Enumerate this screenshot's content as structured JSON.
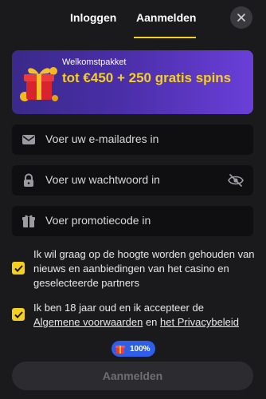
{
  "tabs": {
    "login": "Inloggen",
    "register": "Aanmelden",
    "active": "register"
  },
  "banner": {
    "title": "Welkomstpakket",
    "offer": "tot €450 + 250 gratis spins"
  },
  "form": {
    "email_placeholder": "Voer uw e-mailadres in",
    "password_placeholder": "Voer uw wachtwoord in",
    "promo_placeholder": "Voer promotiecode in"
  },
  "consents": {
    "newsletter": {
      "checked": true,
      "text": "Ik wil graag op de hoogte worden gehouden van nieuws en aanbiedingen van het casino en geselecteerde partners"
    },
    "terms": {
      "checked": true,
      "text_before": "Ik ben 18 jaar oud en ik accepteer de",
      "terms_link": "Algemene voorwaarden",
      "conjunction": "en",
      "privacy_link": "het Privacybeleid"
    }
  },
  "progress": {
    "label": "100%",
    "value": 100
  },
  "submit_label": "Aanmelden",
  "colors": {
    "accent": "#f5d020",
    "background": "#1a1a1d",
    "field": "#0f0f11",
    "badge": "#2f5fe8"
  },
  "icons": [
    "close-icon",
    "gift-icon",
    "email-icon",
    "lock-icon",
    "eye-off-icon",
    "promo-gift-icon",
    "checkmark-icon"
  ]
}
